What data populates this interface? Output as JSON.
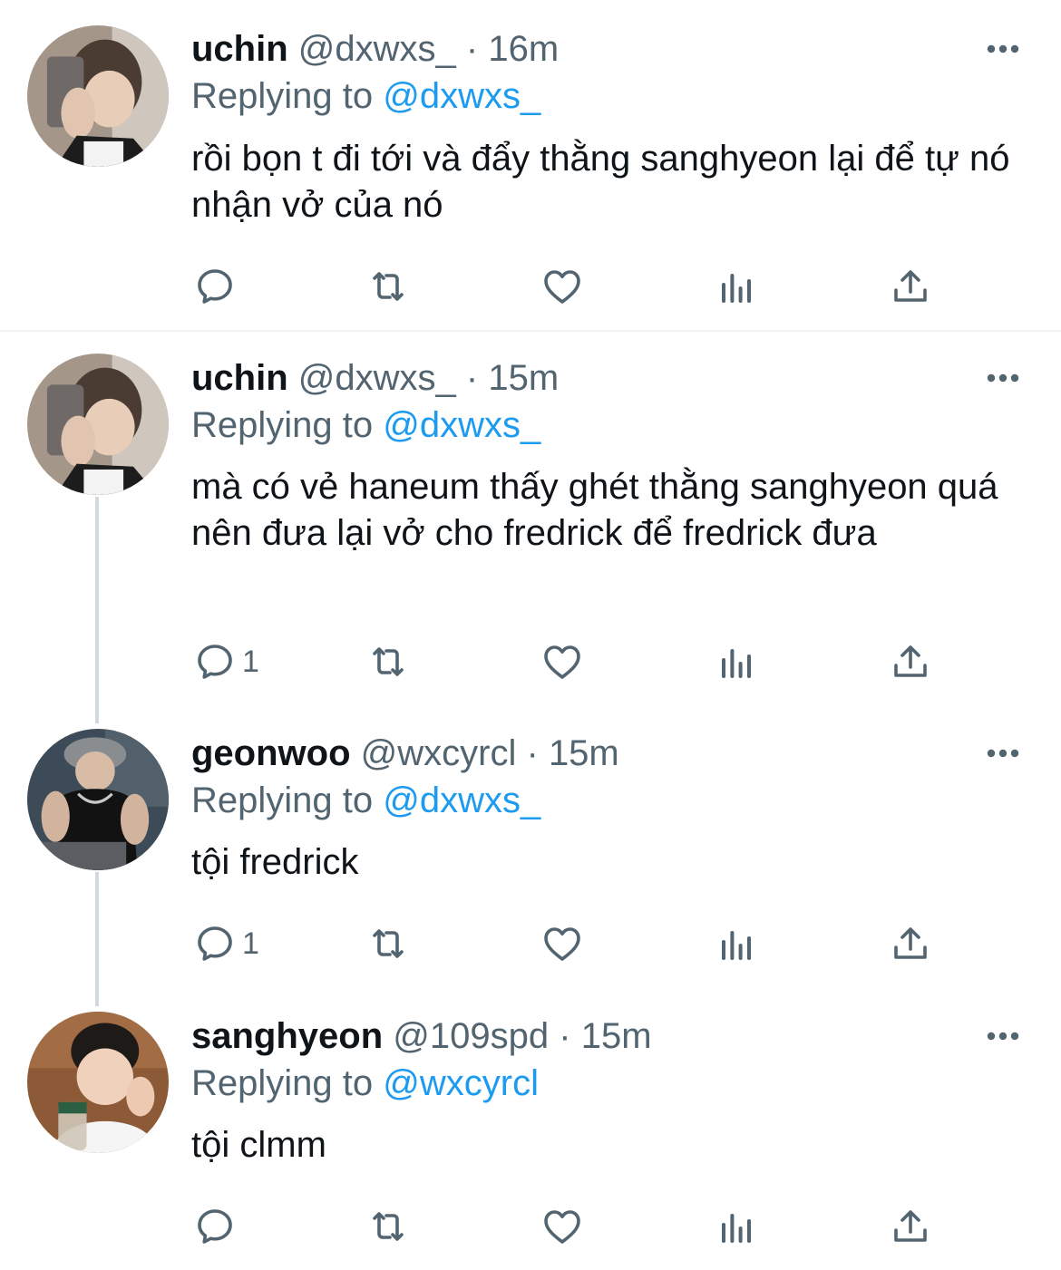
{
  "tweets": [
    {
      "name": "uchin",
      "handle": "@dxwxs_",
      "dot": "·",
      "time": "16m",
      "reply_prefix": "Replying to",
      "reply_to": "@dxwxs_",
      "text": "rồi bọn t đi tới và đẩy thằng sanghyeon lại để tự nó nhận vở của nó",
      "reply_count": ""
    },
    {
      "name": "uchin",
      "handle": "@dxwxs_",
      "dot": "·",
      "time": "15m",
      "reply_prefix": "Replying to",
      "reply_to": "@dxwxs_",
      "text": "mà có vẻ haneum thấy ghét thằng sanghyeon quá nên đưa lại vở cho fredrick để fredrick đưa",
      "reply_count": "1"
    },
    {
      "name": "geonwoo",
      "handle": "@wxcyrcl",
      "dot": "·",
      "time": "15m",
      "reply_prefix": "Replying to",
      "reply_to": "@dxwxs_",
      "text": "tội fredrick",
      "reply_count": "1"
    },
    {
      "name": "sanghyeon",
      "handle": "@109spd",
      "dot": "·",
      "time": "15m",
      "reply_prefix": "Replying to",
      "reply_to": "@wxcyrcl",
      "text": "tội clmm",
      "reply_count": ""
    }
  ],
  "icons": {
    "reply": "reply-icon",
    "retweet": "retweet-icon",
    "like": "heart-icon",
    "views": "views-icon",
    "share": "share-icon",
    "more": "more-icon"
  },
  "colors": {
    "text": "#0f1419",
    "secondary": "#536471",
    "link": "#1d9bf0",
    "thread_line": "#cfd9de"
  }
}
